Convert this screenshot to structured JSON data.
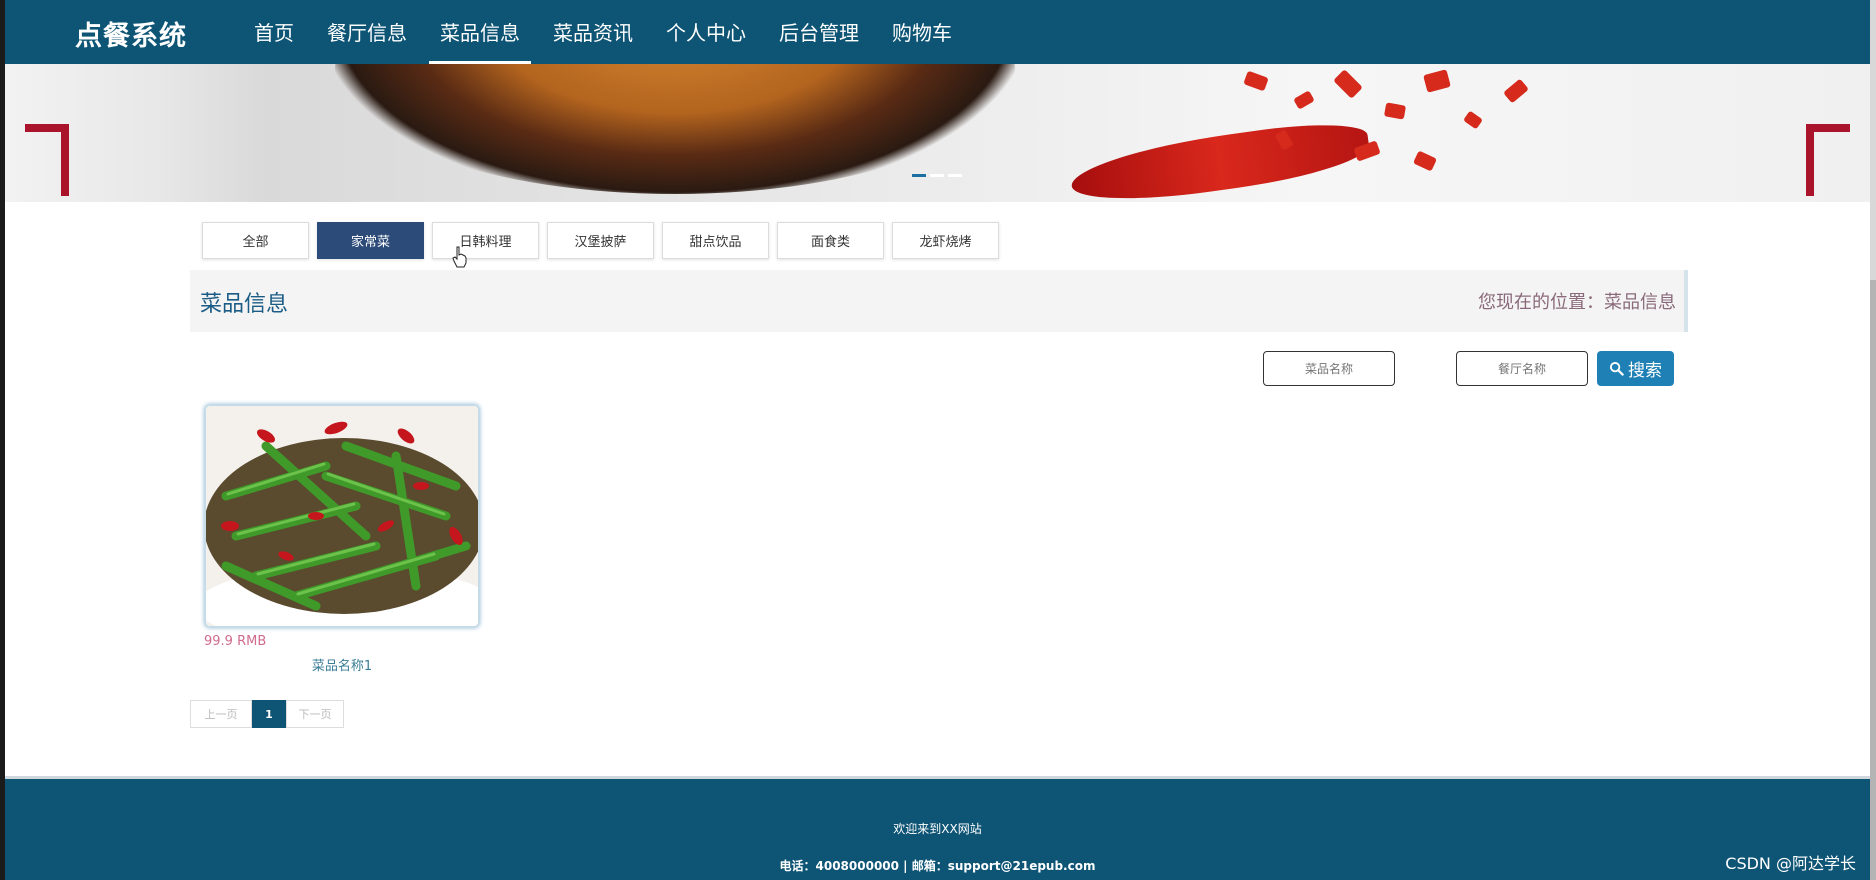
{
  "header": {
    "logo": "点餐系统",
    "nav": [
      {
        "label": "首页"
      },
      {
        "label": "餐厅信息"
      },
      {
        "label": "菜品信息",
        "active": true
      },
      {
        "label": "菜品资讯"
      },
      {
        "label": "个人中心"
      },
      {
        "label": "后台管理"
      },
      {
        "label": "购物车"
      }
    ]
  },
  "banner": {
    "slides": 3,
    "active_slide": 1
  },
  "categories": [
    {
      "label": "全部"
    },
    {
      "label": "家常菜",
      "active": true
    },
    {
      "label": "日韩料理"
    },
    {
      "label": "汉堡披萨"
    },
    {
      "label": "甜点饮品"
    },
    {
      "label": "面食类"
    },
    {
      "label": "龙虾烧烤"
    }
  ],
  "section": {
    "title": "菜品信息",
    "breadcrumb": "您现在的位置：菜品信息"
  },
  "search": {
    "dish_placeholder": "菜品名称",
    "restaurant_placeholder": "餐厅名称",
    "button_label": "搜索"
  },
  "dishes": [
    {
      "price": "99.9 RMB",
      "name": "菜品名称1"
    }
  ],
  "pagination": {
    "prev": "上一页",
    "current": "1",
    "next": "下一页"
  },
  "footer": {
    "welcome": "欢迎来到XX网站",
    "contact": "电话：4008000000 | 邮箱：support@21epub.com"
  },
  "watermark": "CSDN @阿达学长",
  "colors": {
    "primary": "#0d5475",
    "active_category": "#2d4b79",
    "search_button": "#1f80b5",
    "price": "#d06a8e"
  }
}
